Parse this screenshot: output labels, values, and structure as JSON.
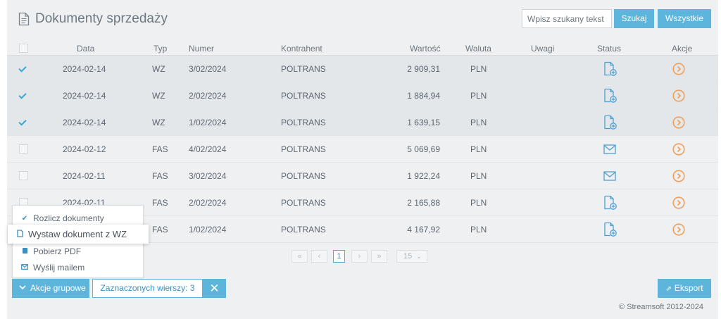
{
  "header": {
    "title": "Dokumenty sprzedaży",
    "search_placeholder": "Wpisz szukany tekst",
    "search_button": "Szukaj",
    "all_button": "Wszystkie"
  },
  "table": {
    "columns": {
      "data": "Data",
      "typ": "Typ",
      "numer": "Numer",
      "kontrahent": "Kontrahent",
      "wartosc": "Wartość",
      "waluta": "Waluta",
      "uwagi": "Uwagi",
      "status": "Status",
      "akcje": "Akcje"
    },
    "rows": [
      {
        "selected": true,
        "date": "2024-02-14",
        "type": "WZ",
        "number": "3/02/2024",
        "contractor": "POLTRANS",
        "value": "2 909,31",
        "currency": "PLN",
        "notes": "",
        "status_icon": "file-add-icon"
      },
      {
        "selected": true,
        "date": "2024-02-14",
        "type": "WZ",
        "number": "2/02/2024",
        "contractor": "POLTRANS",
        "value": "1 884,94",
        "currency": "PLN",
        "notes": "",
        "status_icon": "file-add-icon"
      },
      {
        "selected": true,
        "date": "2024-02-14",
        "type": "WZ",
        "number": "1/02/2024",
        "contractor": "POLTRANS",
        "value": "1 639,15",
        "currency": "PLN",
        "notes": "",
        "status_icon": "file-add-icon"
      },
      {
        "selected": false,
        "date": "2024-02-12",
        "type": "FAS",
        "number": "4/02/2024",
        "contractor": "POLTRANS",
        "value": "5 069,69",
        "currency": "PLN",
        "notes": "",
        "status_icon": "envelope-icon"
      },
      {
        "selected": false,
        "date": "2024-02-11",
        "type": "FAS",
        "number": "3/02/2024",
        "contractor": "POLTRANS",
        "value": "1 922,24",
        "currency": "PLN",
        "notes": "",
        "status_icon": "envelope-icon"
      },
      {
        "selected": false,
        "date": "2024-02-11",
        "type": "FAS",
        "number": "2/02/2024",
        "contractor": "POLTRANS",
        "value": "2 165,88",
        "currency": "PLN",
        "notes": "",
        "status_icon": "file-add-icon"
      },
      {
        "selected": false,
        "date": "",
        "type": "FAS",
        "number": "1/02/2024",
        "contractor": "POLTRANS",
        "value": "4 167,92",
        "currency": "PLN",
        "notes": "",
        "status_icon": "file-add-icon"
      }
    ]
  },
  "pagination": {
    "first": "«",
    "prev": "‹",
    "current_page": "1",
    "next": "›",
    "last": "»",
    "page_size": "15"
  },
  "group_menu": {
    "items": [
      {
        "label": "Rozlicz dokumenty",
        "icon": "check-icon"
      },
      {
        "label": "Wystaw dokument z WZ",
        "icon": "document-icon"
      },
      {
        "label": "Pobierz PDF",
        "icon": "pdf-icon"
      },
      {
        "label": "Wyślij mailem",
        "icon": "mail-icon"
      }
    ]
  },
  "footer": {
    "group_actions_button": "Akcje grupowe",
    "selected_rows": "Zaznaczonych wierszy: 3",
    "clear_button": "✕",
    "export_button": "Eksport",
    "copyright": "© Streamsoft 2012-2024"
  },
  "colors": {
    "accent": "#5db5dc",
    "action_orange": "#f0a05c",
    "status_blue": "#4f9fd0"
  }
}
